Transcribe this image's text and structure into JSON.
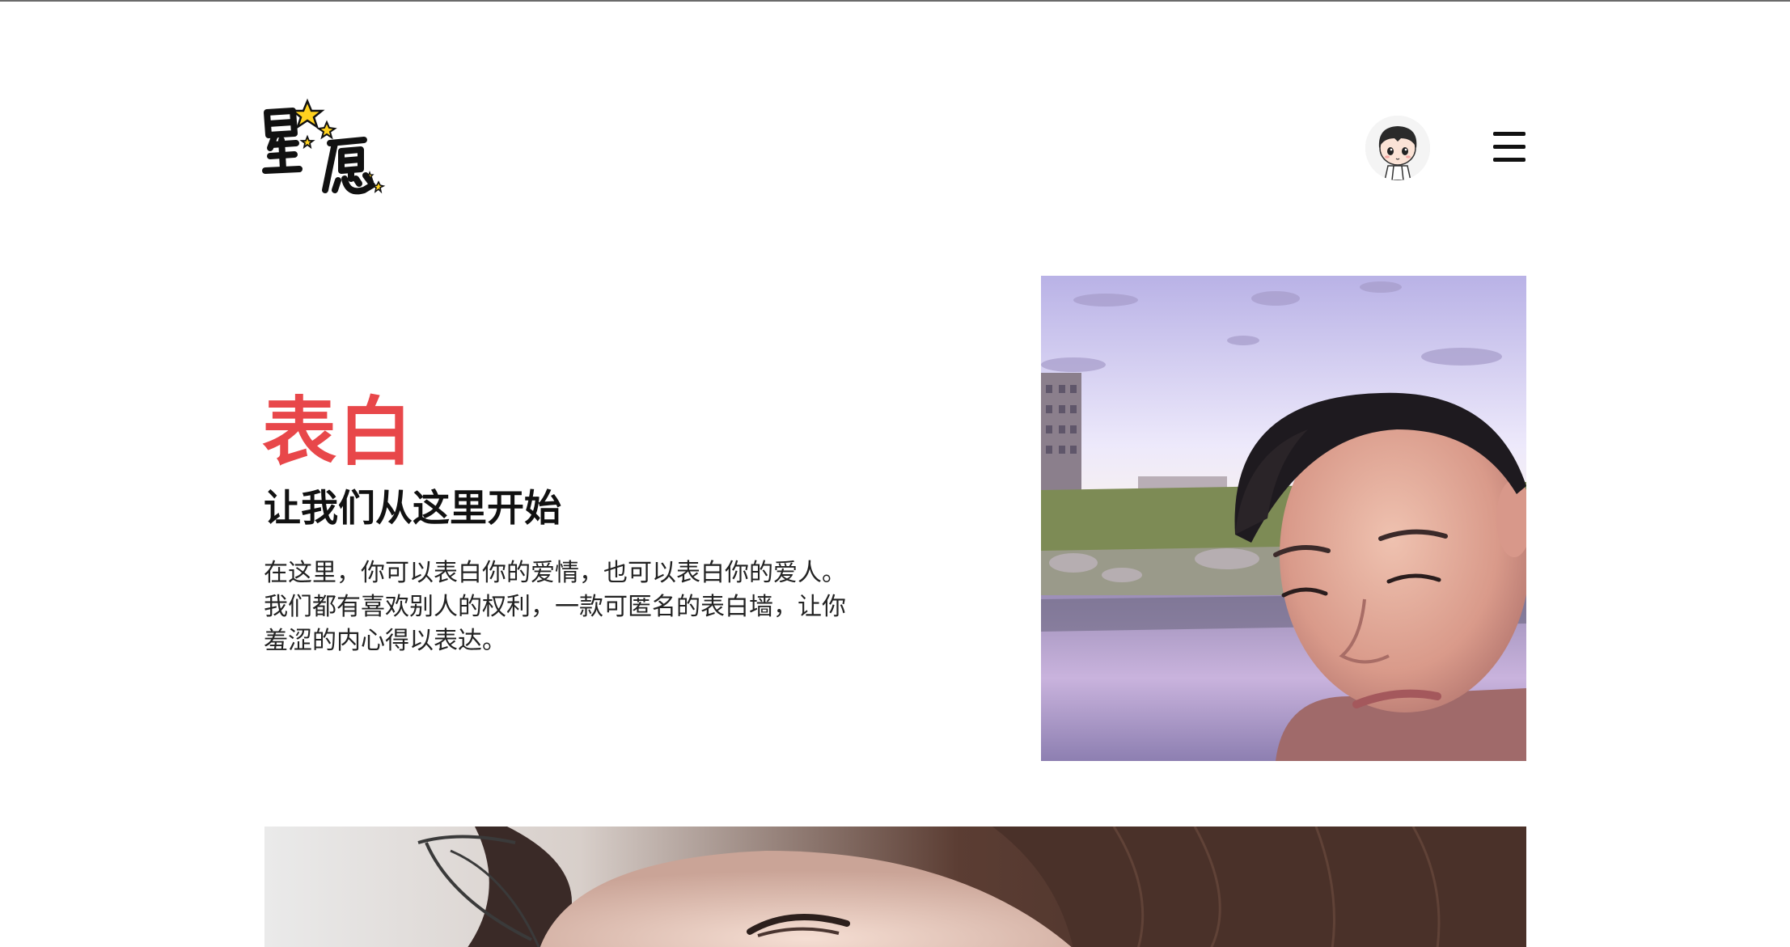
{
  "header": {
    "logo_text": "星愿",
    "logo_icon": "star-logo-icon",
    "avatar_icon": "cartoon-avatar-icon",
    "menu_icon": "hamburger-menu-icon"
  },
  "hero": {
    "title": "表白",
    "subtitle": "让我们从这里开始",
    "description": "在这里，你可以表白你的爱情，也可以表白你的爱人。我们都有喜欢别人的权利，一款可匿名的表白墙，让你羞涩的内心得以表达。",
    "photo_icon": "portrait-photo",
    "accent_color": "#e8474a"
  },
  "feature": {
    "photo_icon": "portrait-photo-2"
  }
}
